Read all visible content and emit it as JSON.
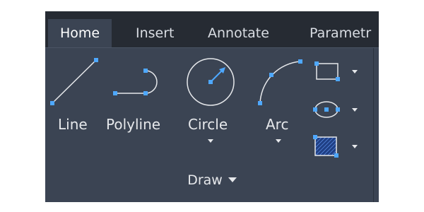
{
  "tabs": [
    {
      "label": "Home",
      "active": true
    },
    {
      "label": "Insert",
      "active": false
    },
    {
      "label": "Annotate",
      "active": false
    },
    {
      "label": "Parametr",
      "active": false
    }
  ],
  "tools": {
    "line": {
      "label": "Line",
      "icon": "line-icon"
    },
    "polyline": {
      "label": "Polyline",
      "icon": "polyline-icon"
    },
    "circle": {
      "label": "Circle",
      "icon": "circle-icon"
    },
    "arc": {
      "label": "Arc",
      "icon": "arc-icon"
    },
    "rectangle": {
      "icon": "rectangle-icon"
    },
    "ellipse": {
      "icon": "ellipse-icon"
    },
    "hatch": {
      "icon": "hatch-icon"
    }
  },
  "panel": {
    "title": "Draw"
  },
  "colors": {
    "ribbon_bg": "#3b4453",
    "tabbar_bg": "#262b33",
    "grip_blue": "#4ea8ff",
    "stroke": "#e6e8eb"
  }
}
